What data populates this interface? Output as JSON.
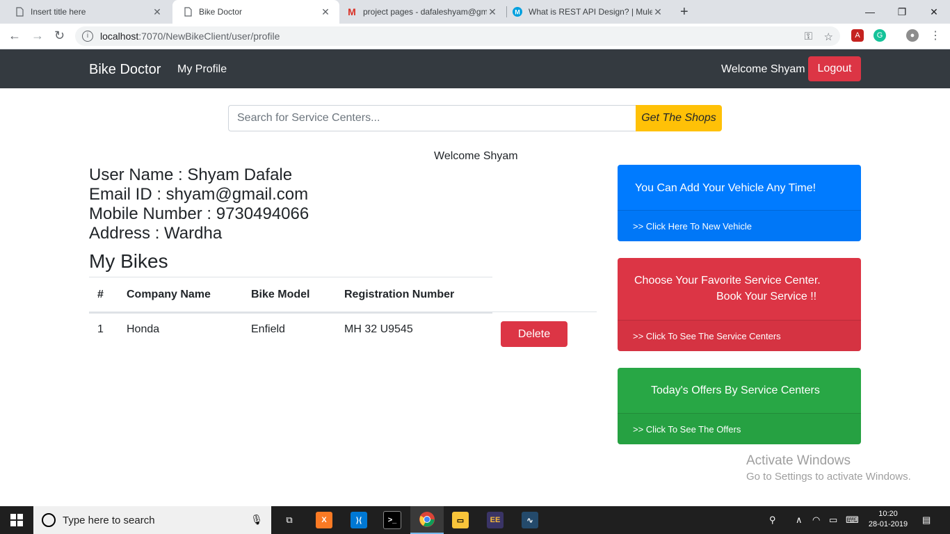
{
  "browser": {
    "tabs": [
      {
        "title": "Insert title here",
        "icon": "page-icon",
        "active": false
      },
      {
        "title": "Bike Doctor",
        "icon": "page-icon",
        "active": true
      },
      {
        "title": "project pages - dafaleshyam@gm",
        "icon": "gmail-icon",
        "active": false
      },
      {
        "title": "What is REST API Design? | MuleS",
        "icon": "mulesoft-icon",
        "active": false
      }
    ],
    "url_host": "localhost",
    "url_path": ":7070/NewBikeClient/user/profile"
  },
  "nav": {
    "brand": "Bike Doctor",
    "my_profile": "My Profile",
    "welcome": "Welcome Shyam",
    "logout": "Logout"
  },
  "search": {
    "placeholder": "Search for Service Centers...",
    "button": "Get The Shops"
  },
  "welcome_text": "Welcome Shyam",
  "profile": {
    "user_name": "User Name : Shyam Dafale",
    "email": "Email ID : shyam@gmail.com",
    "mobile": "Mobile Number : 9730494066",
    "address": "Address : Wardha"
  },
  "bikes": {
    "heading": "My Bikes",
    "columns": [
      "#",
      "Company Name",
      "Bike Model",
      "Registration Number"
    ],
    "rows": [
      {
        "num": "1",
        "company": "Honda",
        "model": "Enfield",
        "registration": "MH 32 U9545",
        "action": "Delete"
      }
    ]
  },
  "cards": {
    "vehicle": {
      "body": "You Can Add Your Vehicle Any Time!",
      "footer": ">> Click Here To New Vehicle",
      "color": "#007bff"
    },
    "service": {
      "body_line1": "Choose Your Favorite Service Center.",
      "body_line2": "Book Your Service !!",
      "footer": ">> Click To See The Service Centers",
      "color": "#dc3545"
    },
    "offers": {
      "body": "Today's Offers By Service Centers",
      "footer": ">> Click To See The Offers",
      "color": "#28a745"
    }
  },
  "watermark": {
    "line1": "Activate Windows",
    "line2": "Go to Settings to activate Windows."
  },
  "taskbar": {
    "search_placeholder": "Type here to search",
    "time": "10:20",
    "date": "28-01-2019"
  }
}
